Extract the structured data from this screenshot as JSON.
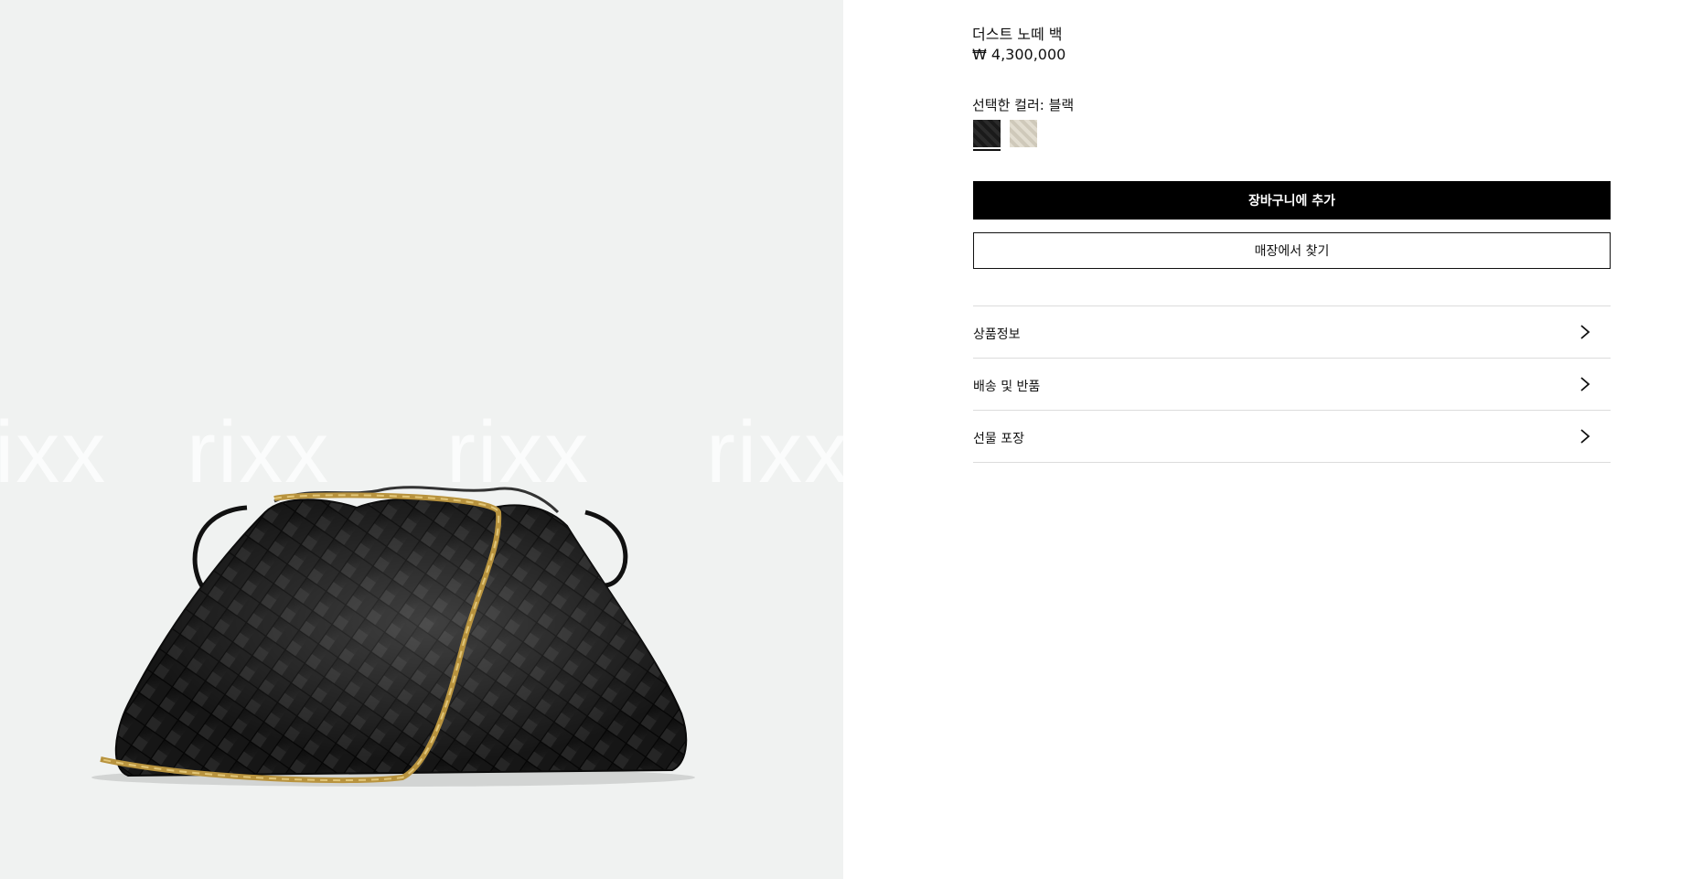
{
  "product": {
    "title": "더스트 노떼 백",
    "price": "₩ 4,300,000"
  },
  "color_selection": {
    "label": "선택한 컬러: 블랙",
    "swatches": [
      {
        "name": "블랙",
        "color": "#1a1a1a",
        "selected": true
      },
      {
        "name": "cream",
        "color": "#dcd6c8",
        "selected": false
      }
    ]
  },
  "actions": {
    "add_to_cart": "장바구니에 추가",
    "find_in_store": "매장에서 찾기"
  },
  "accordion": [
    {
      "label": "상품정보"
    },
    {
      "label": "배송 및 반품"
    },
    {
      "label": "선물 포장"
    }
  ],
  "image": {
    "watermark": "rixx",
    "background": "#f0f2f1"
  }
}
